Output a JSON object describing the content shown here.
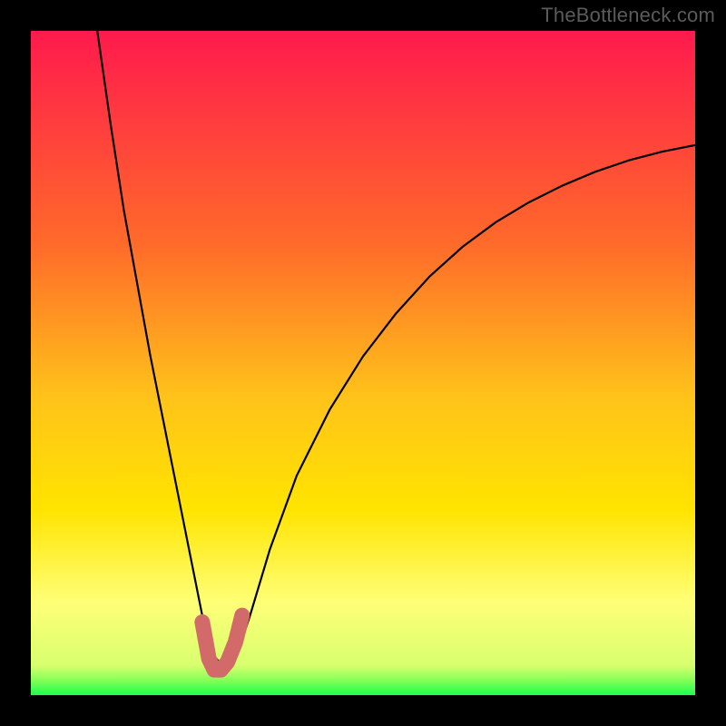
{
  "watermark": "TheBottleneck.com",
  "chart_data": {
    "type": "line",
    "title": "",
    "xlabel": "",
    "ylabel": "",
    "xlim": [
      0,
      100
    ],
    "ylim": [
      0,
      100
    ],
    "background_gradient": {
      "top": "#ff1a4d",
      "mid_upper": "#ff8a1f",
      "mid": "#ffe400",
      "lower": "#ffff77",
      "bottom": "#1cff4a"
    },
    "series": [
      {
        "name": "curve",
        "color": "#000000",
        "x": [
          10,
          12,
          14,
          16,
          18,
          20,
          22,
          24,
          25.8,
          27.5,
          29.2,
          31,
          33,
          36,
          40,
          45,
          50,
          55,
          60,
          65,
          70,
          75,
          80,
          85,
          90,
          95,
          100
        ],
        "y": [
          100,
          86,
          73,
          62,
          51,
          41,
          31,
          21,
          12,
          6,
          4,
          6,
          12,
          22,
          33,
          43,
          51,
          57.5,
          63,
          67.5,
          71.2,
          74.2,
          76.7,
          78.8,
          80.5,
          81.8,
          82.8
        ]
      },
      {
        "name": "highlight",
        "color": "#d36a6a",
        "thick": true,
        "x": [
          25.8,
          26.8,
          27.6,
          28.6,
          29.6,
          30.8,
          31.8
        ],
        "y": [
          11,
          5.5,
          3.8,
          3.8,
          5.0,
          8.0,
          12
        ]
      }
    ]
  }
}
